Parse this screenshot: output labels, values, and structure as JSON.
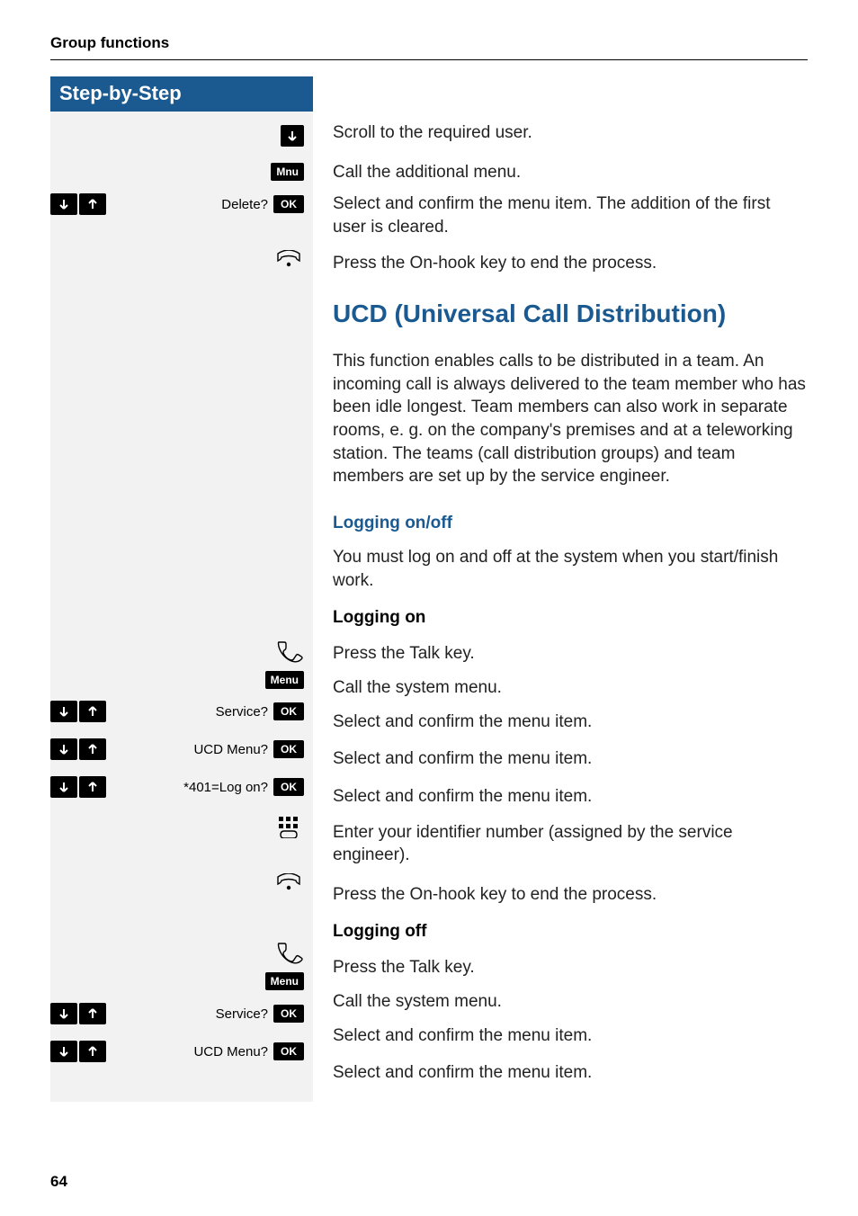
{
  "header": "Group functions",
  "step_header": "Step-by-Step",
  "page_number": "64",
  "buttons": {
    "mnu": "Mnu",
    "ok": "OK",
    "menu": "Menu"
  },
  "menu_labels": {
    "delete": "Delete?",
    "service": "Service?",
    "ucd_menu": "UCD Menu?",
    "log_on": "*401=Log on?"
  },
  "section1": {
    "scroll": "Scroll to the required user.",
    "call_menu": "Call the additional menu.",
    "select_confirm": "Select and confirm the menu item. The addition of the first user is cleared.",
    "onhook": "Press the On-hook key to end the process."
  },
  "ucd": {
    "title": "UCD (Universal Call Distribution)",
    "intro": "This function enables calls to be distributed in a team. An incoming call is always delivered to the team member who has been idle longest. Team members can also work in separate rooms, e. g. on the company's premises and at a teleworking station. The teams (call distribution groups) and team members are set up by the service engineer.",
    "logging_onoff_title": "Logging on/off",
    "logging_onoff_desc": "You must log on and off at the system when you start/finish work.",
    "logging_on_title": "Logging on",
    "press_talk": "Press the Talk key.",
    "call_system_menu": "Call the system menu.",
    "select_confirm": "Select and confirm the menu item.",
    "enter_id": "Enter your identifier number (assigned by the service engineer).",
    "onhook": "Press the On-hook key to end the process.",
    "logging_off_title": "Logging off"
  }
}
